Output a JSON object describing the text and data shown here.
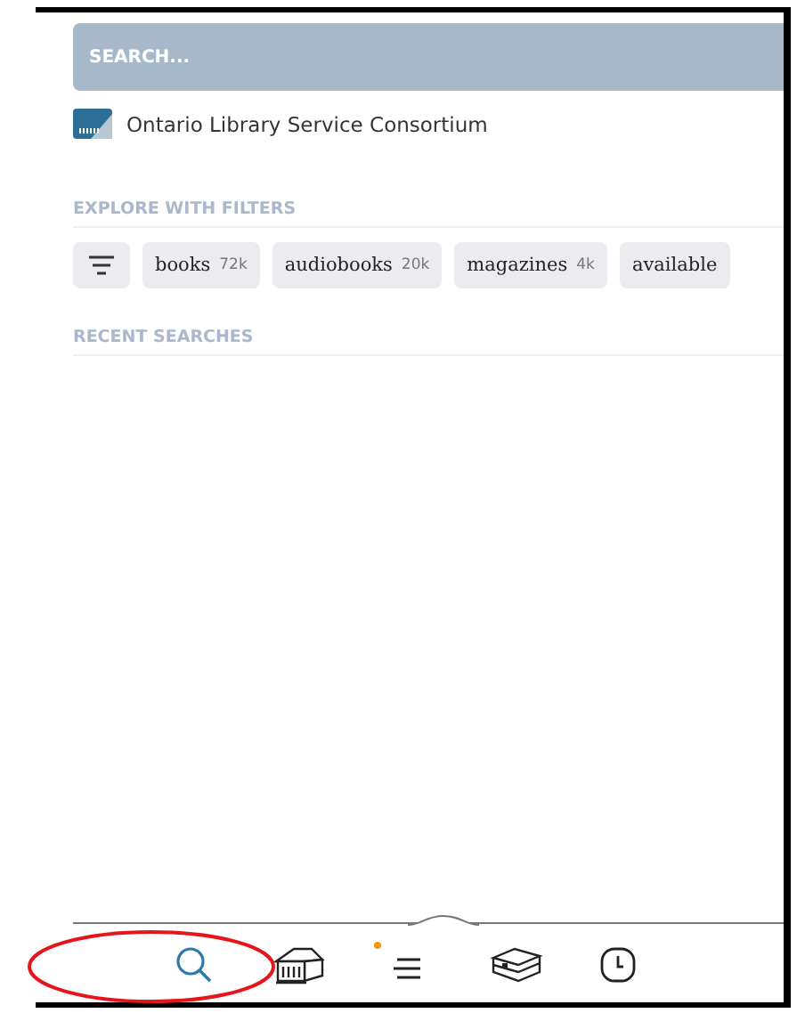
{
  "search": {
    "placeholder": "SEARCH..."
  },
  "library": {
    "name": "Ontario Library Service Consortium"
  },
  "filters": {
    "heading": "EXPLORE WITH FILTERS",
    "chips": [
      {
        "label": "books",
        "count": "72k"
      },
      {
        "label": "audiobooks",
        "count": "20k"
      },
      {
        "label": "magazines",
        "count": "4k"
      },
      {
        "label": "available"
      }
    ]
  },
  "recent": {
    "heading": "RECENT SEARCHES"
  },
  "nav": [
    {
      "kind": "search",
      "selected": true
    },
    {
      "kind": "library",
      "selected": false
    },
    {
      "kind": "menu",
      "selected": false,
      "notification": true
    },
    {
      "kind": "shelf",
      "selected": false
    },
    {
      "kind": "history",
      "selected": false
    }
  ]
}
